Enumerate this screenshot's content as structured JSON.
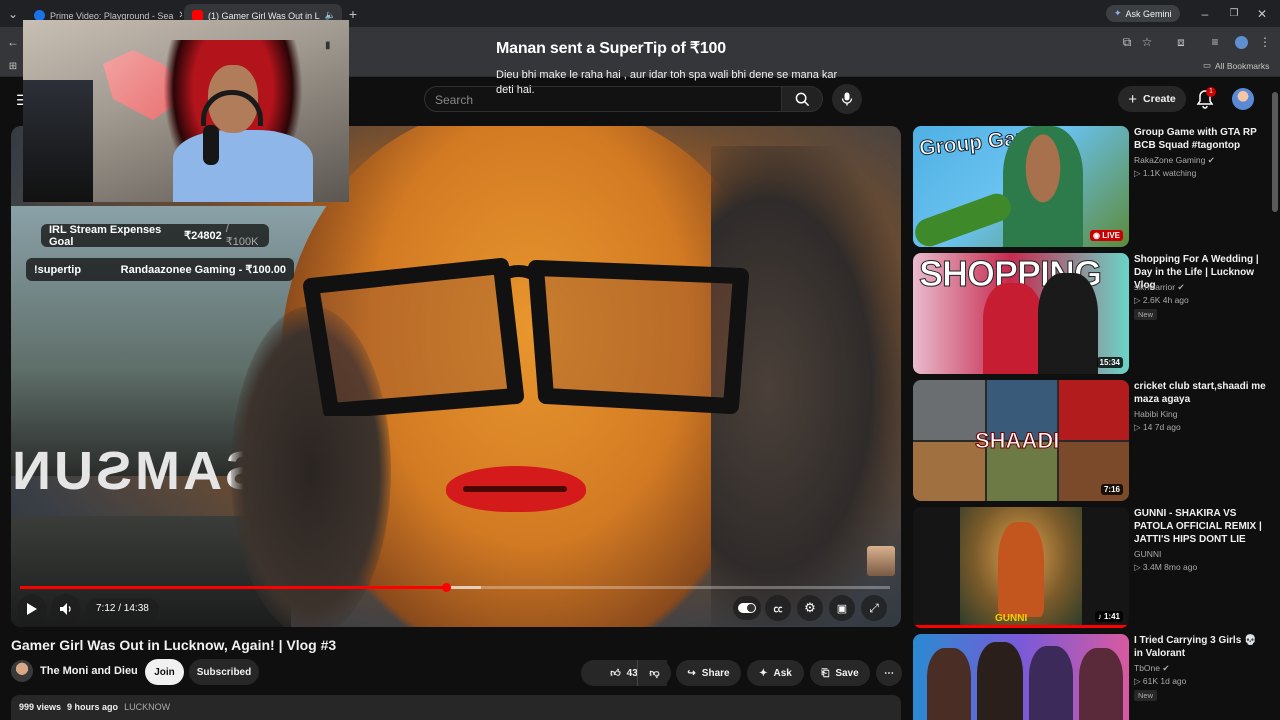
{
  "browser": {
    "tabs": [
      {
        "title": "Prime Video: Playground - Sea",
        "active": false
      },
      {
        "title": "(1) Gamer Girl Was Out in L",
        "active": true
      }
    ],
    "new_tab": "+",
    "ask_gemini": "Ask Gemini",
    "all_bookmarks": "All Bookmarks"
  },
  "header": {
    "search_placeholder": "Search",
    "create_label": "Create",
    "notif_count": "1"
  },
  "overlay": {
    "supertip_title": "Manan sent a SuperTip of ₹100",
    "supertip_message": "Dieu bhi make le raha hai , aur idar toh spa wali bhi dene se mana kar deti hai.",
    "goal_label": "IRL Stream Expenses Goal",
    "goal_current": "₹24802",
    "goal_target": "/ ₹100K",
    "supertip_cmd": "!supertip",
    "supertip_by": "Randaazonee Gaming - ₹100.00",
    "samsung_sign": "SAMSUNG"
  },
  "player": {
    "time": "7:12 / 14:38",
    "progress_fraction": 0.49
  },
  "video": {
    "title": "Gamer Girl Was Out in Lucknow, Again! | Vlog #3",
    "channel": "The Moni and Dieu",
    "join": "Join",
    "subscribed": "Subscribed",
    "likes": "43",
    "share": "Share",
    "ask": "Ask",
    "save": "Save",
    "views": "999 views",
    "age": "9 hours ago",
    "location": "LUCKNOW"
  },
  "recommendations": [
    {
      "title": "Group Game with GTA RP BCB Squad #tagontop",
      "channel": "RakaZone Gaming",
      "meta": "1.1K watching",
      "badge": "LIVE",
      "thumb_text": "Group Games"
    },
    {
      "title": "Shopping For A Wedding | Day in the Life | Lucknow Vlog",
      "channel": "sikhwarrior",
      "meta": "2.6K  4h ago",
      "badge": "15:34",
      "new": "New",
      "thumb_text": "SHOPPING"
    },
    {
      "title": "cricket club start,shaadi me maza agaya",
      "channel": "Habibi King",
      "meta": "14  7d ago",
      "badge": "7:16",
      "thumb_text": "SHAADI"
    },
    {
      "title": "GUNNI - SHAKIRA VS PATOLA OFFICIAL REMIX | JATTI'S HIPS DONT LIE",
      "channel": "GUNNI",
      "meta": "3.4M  8mo ago",
      "badge": "1:41",
      "thumb_text": "GUNNI"
    },
    {
      "title": "I Tried Carrying 3 Girls 💀 in Valorant",
      "channel": "TbOne",
      "meta": "61K  1d ago",
      "new": "New",
      "thumb_text": ""
    }
  ]
}
